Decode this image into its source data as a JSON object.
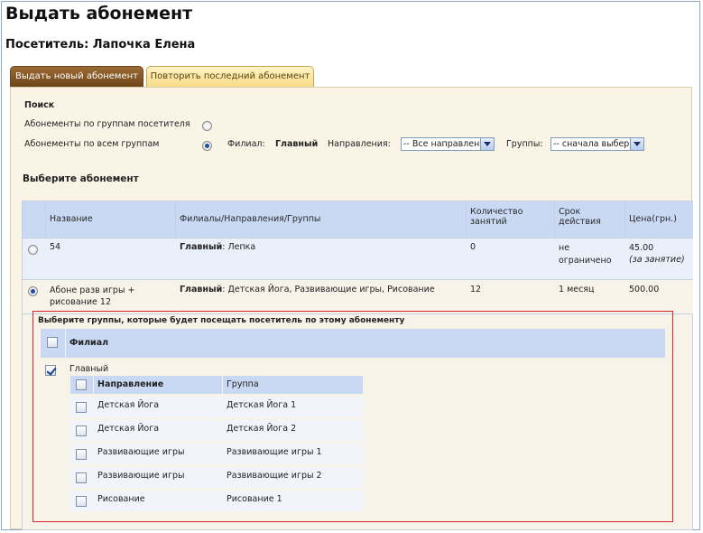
{
  "page_title": "Выдать абонемент",
  "visitor_label": "Посетитель: Лапочка Елена",
  "tabs": [
    {
      "label": "Выдать новый абонемент",
      "active": true
    },
    {
      "label": "Повторить последний абонемент",
      "active": false
    }
  ],
  "search": {
    "heading": "Поиск",
    "option_by_visitor_groups": "Абонементы по группам посетителя",
    "option_all_groups": "Абонементы по всем группам",
    "selected_option": "all_groups",
    "branch_label": "Филиал:",
    "branch_value": "Главный",
    "directions_label": "Направления:",
    "directions_value": "-- Все направления --",
    "groups_label": "Группы:",
    "groups_value": "-- сначала выберите --"
  },
  "choose_heading": "Выберите абонемент",
  "table": {
    "headers": {
      "name": "Название",
      "branches": "Филиалы/Направления/Группы",
      "count": "Количество занятий",
      "term": "Срок действия",
      "price": "Цена(грн.)"
    },
    "rows": [
      {
        "selected": false,
        "name": "54",
        "branch": "Главный",
        "branch_rest": ": Лепка",
        "count": "0",
        "term": "не ограничено",
        "price": "45.00",
        "price_note": "(за занятие)"
      },
      {
        "selected": true,
        "name": "Абоне разв игры + рисование 12",
        "branch": "Главный",
        "branch_rest": ": Детская Йога, Развивающие игры, Рисование",
        "count": "12",
        "term": "1 месяц",
        "price": "500.00",
        "price_note": ""
      }
    ]
  },
  "groups_panel": {
    "title": "Выберите группы, которые будет посещать посетитель по этому абонементу",
    "branch_header": "Филиал",
    "branch_name": "Главный",
    "branch_checked": true,
    "col_direction": "Направление",
    "col_group": "Группа",
    "rows": [
      {
        "direction": "Детская Йога",
        "group": "Детская Йога 1"
      },
      {
        "direction": "Детская Йога",
        "group": "Детская Йога 2"
      },
      {
        "direction": "Развивающие игры",
        "group": "Развивающие игры 1"
      },
      {
        "direction": "Развивающие игры",
        "group": "Развивающие игры 2"
      },
      {
        "direction": "Рисование",
        "group": "Рисование 1"
      }
    ]
  },
  "colors": {
    "header_blue": "#c9d9f4",
    "panel_bg": "#f9f4e6",
    "active_tab": "#7a4f22",
    "inactive_tab": "#f7dc86",
    "highlight_border": "#d6252b"
  }
}
